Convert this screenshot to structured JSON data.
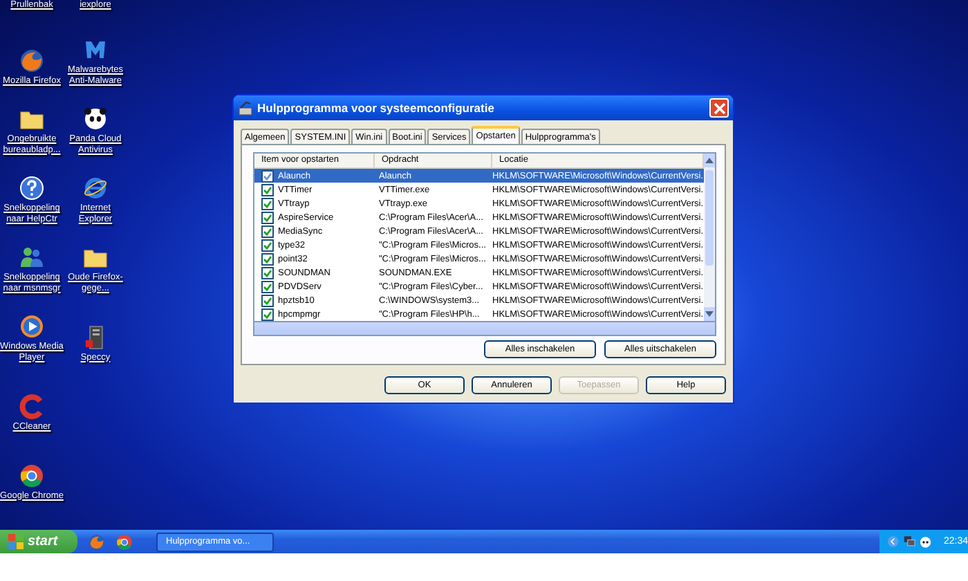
{
  "desktop": {
    "icons": [
      {
        "label": "Prullenbak",
        "kind": "cut"
      },
      {
        "label": "Mozilla Firefox",
        "kind": "firefox"
      },
      {
        "label": "Ongebruikte bureaubladp...",
        "kind": "folder"
      },
      {
        "label": "Snelkoppeling naar HelpCtr",
        "kind": "help"
      },
      {
        "label": "Snelkoppeling naar msnmsgr",
        "kind": "msn"
      },
      {
        "label": "Windows Media Player",
        "kind": "wmp"
      },
      {
        "label": "CCleaner",
        "kind": "ccleaner"
      },
      {
        "label": "Google Chrome",
        "kind": "chrome"
      },
      {
        "label": "iexplore",
        "kind": "cut"
      },
      {
        "label": "Malwarebytes Anti-Malware",
        "kind": "malwarebytes"
      },
      {
        "label": "Panda Cloud Antivirus",
        "kind": "panda"
      },
      {
        "label": "Internet Explorer",
        "kind": "ie"
      },
      {
        "label": "Oude Firefox-gege...",
        "kind": "folder"
      },
      {
        "label": "Speccy",
        "kind": "speccy"
      }
    ]
  },
  "window": {
    "title": "Hulpprogramma voor systeemconfiguratie"
  },
  "tabs": [
    {
      "label": "Algemeen",
      "selected": false
    },
    {
      "label": "SYSTEM.INI",
      "selected": false
    },
    {
      "label": "Win.ini",
      "selected": false
    },
    {
      "label": "Boot.ini",
      "selected": false
    },
    {
      "label": "Services",
      "selected": false
    },
    {
      "label": "Opstarten",
      "selected": true
    },
    {
      "label": "Hulpprogramma's",
      "selected": false
    }
  ],
  "table": {
    "columns": [
      "Item voor opstarten",
      "Opdracht",
      "Locatie"
    ],
    "rows": [
      {
        "name": "Alaunch",
        "command": "Alaunch",
        "location": "HKLM\\SOFTWARE\\Microsoft\\Windows\\CurrentVersi.",
        "checked": true,
        "selected": true
      },
      {
        "name": "VTTimer",
        "command": "VTTimer.exe",
        "location": "HKLM\\SOFTWARE\\Microsoft\\Windows\\CurrentVersi.",
        "checked": true,
        "selected": false
      },
      {
        "name": "VTtrayp",
        "command": "VTtrayp.exe",
        "location": "HKLM\\SOFTWARE\\Microsoft\\Windows\\CurrentVersi.",
        "checked": true,
        "selected": false
      },
      {
        "name": "AspireService",
        "command": "C:\\Program Files\\Acer\\A...",
        "location": "HKLM\\SOFTWARE\\Microsoft\\Windows\\CurrentVersi.",
        "checked": true,
        "selected": false
      },
      {
        "name": "MediaSync",
        "command": "C:\\Program Files\\Acer\\A...",
        "location": "HKLM\\SOFTWARE\\Microsoft\\Windows\\CurrentVersi.",
        "checked": true,
        "selected": false
      },
      {
        "name": "type32",
        "command": "\"C:\\Program Files\\Micros...",
        "location": "HKLM\\SOFTWARE\\Microsoft\\Windows\\CurrentVersi.",
        "checked": true,
        "selected": false
      },
      {
        "name": "point32",
        "command": "\"C:\\Program Files\\Micros...",
        "location": "HKLM\\SOFTWARE\\Microsoft\\Windows\\CurrentVersi.",
        "checked": true,
        "selected": false
      },
      {
        "name": "SOUNDMAN",
        "command": "SOUNDMAN.EXE",
        "location": "HKLM\\SOFTWARE\\Microsoft\\Windows\\CurrentVersi.",
        "checked": true,
        "selected": false
      },
      {
        "name": "PDVDServ",
        "command": "\"C:\\Program Files\\Cyber...",
        "location": "HKLM\\SOFTWARE\\Microsoft\\Windows\\CurrentVersi.",
        "checked": true,
        "selected": false
      },
      {
        "name": "hpztsb10",
        "command": "C:\\WINDOWS\\system3...",
        "location": "HKLM\\SOFTWARE\\Microsoft\\Windows\\CurrentVersi.",
        "checked": true,
        "selected": false
      },
      {
        "name": "hpcmpmgr",
        "command": "\"C:\\Program Files\\HP\\h...",
        "location": "HKLM\\SOFTWARE\\Microsoft\\Windows\\CurrentVersi.",
        "checked": true,
        "selected": false
      }
    ]
  },
  "list_buttons": [
    "Alles inschakelen",
    "Alles uitschakelen"
  ],
  "buttons": [
    {
      "label": "OK",
      "disabled": false
    },
    {
      "label": "Annuleren",
      "disabled": false
    },
    {
      "label": "Toepassen",
      "disabled": true
    },
    {
      "label": "Help",
      "disabled": false
    }
  ],
  "taskbar": {
    "start": "start",
    "task": "Hulpprogramma vo...",
    "clock": "22:34"
  }
}
